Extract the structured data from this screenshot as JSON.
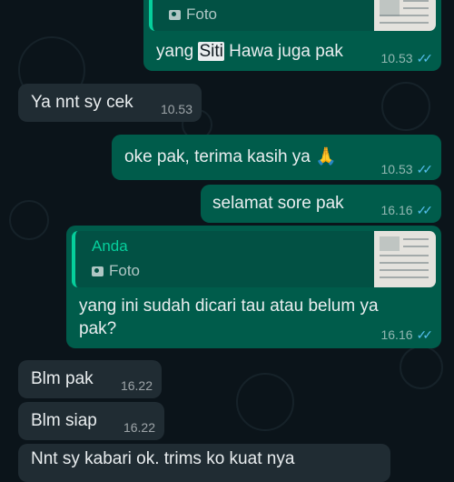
{
  "colors": {
    "background": "#0b141a",
    "outgoing_bubble": "#005c4b",
    "incoming_bubble": "#202c33",
    "quote_accent": "#06cf9c",
    "read_ticks": "#53bdeb"
  },
  "messages": [
    {
      "id": "m1",
      "direction": "outgoing",
      "quote": {
        "type_label": "Foto",
        "icon": "camera-icon"
      },
      "text_before": "yang ",
      "text_highlight": "Siti",
      "text_after": " Hawa juga pak",
      "time": "10.53",
      "status_icon": "double-check-icon"
    },
    {
      "id": "m2",
      "direction": "incoming",
      "text": "Ya nnt sy cek",
      "time": "10.53"
    },
    {
      "id": "m3",
      "direction": "outgoing",
      "text": "oke pak, terima kasih ya 🙏",
      "time": "10.53",
      "status_icon": "double-check-icon"
    },
    {
      "id": "m4",
      "direction": "outgoing",
      "text": "selamat sore pak",
      "time": "16.16",
      "status_icon": "double-check-icon"
    },
    {
      "id": "m5",
      "direction": "outgoing",
      "quote": {
        "author": "Anda",
        "type_label": "Foto",
        "icon": "camera-icon"
      },
      "text_line1": "yang ini sudah dicari tau atau belum ya",
      "text_line2": "pak?",
      "time": "16.16",
      "status_icon": "double-check-icon"
    },
    {
      "id": "m6",
      "direction": "incoming",
      "text": "Blm pak",
      "time": "16.22"
    },
    {
      "id": "m7",
      "direction": "incoming",
      "text": "Blm siap",
      "time": "16.22"
    },
    {
      "id": "m8",
      "direction": "incoming",
      "text": "Nnt sy kabari ok. trims ko kuat nya",
      "partially_visible": true
    }
  ]
}
